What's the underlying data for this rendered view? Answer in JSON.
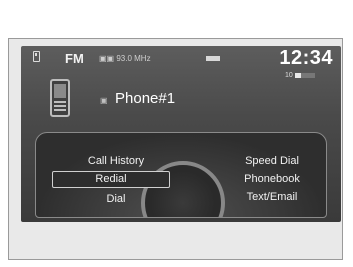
{
  "status": {
    "band": "FM",
    "station": "▣▣ 93.0 MHz",
    "battery_label": "▯▯",
    "time": "12:34",
    "signal_label": "10"
  },
  "phone": {
    "name": "Phone#1",
    "bt_label": "▣"
  },
  "menu": {
    "left": [
      "Call History",
      "Redial",
      "Dial"
    ],
    "right": [
      "Speed Dial",
      "Phonebook",
      "Text/Email"
    ],
    "selected": "Redial"
  }
}
